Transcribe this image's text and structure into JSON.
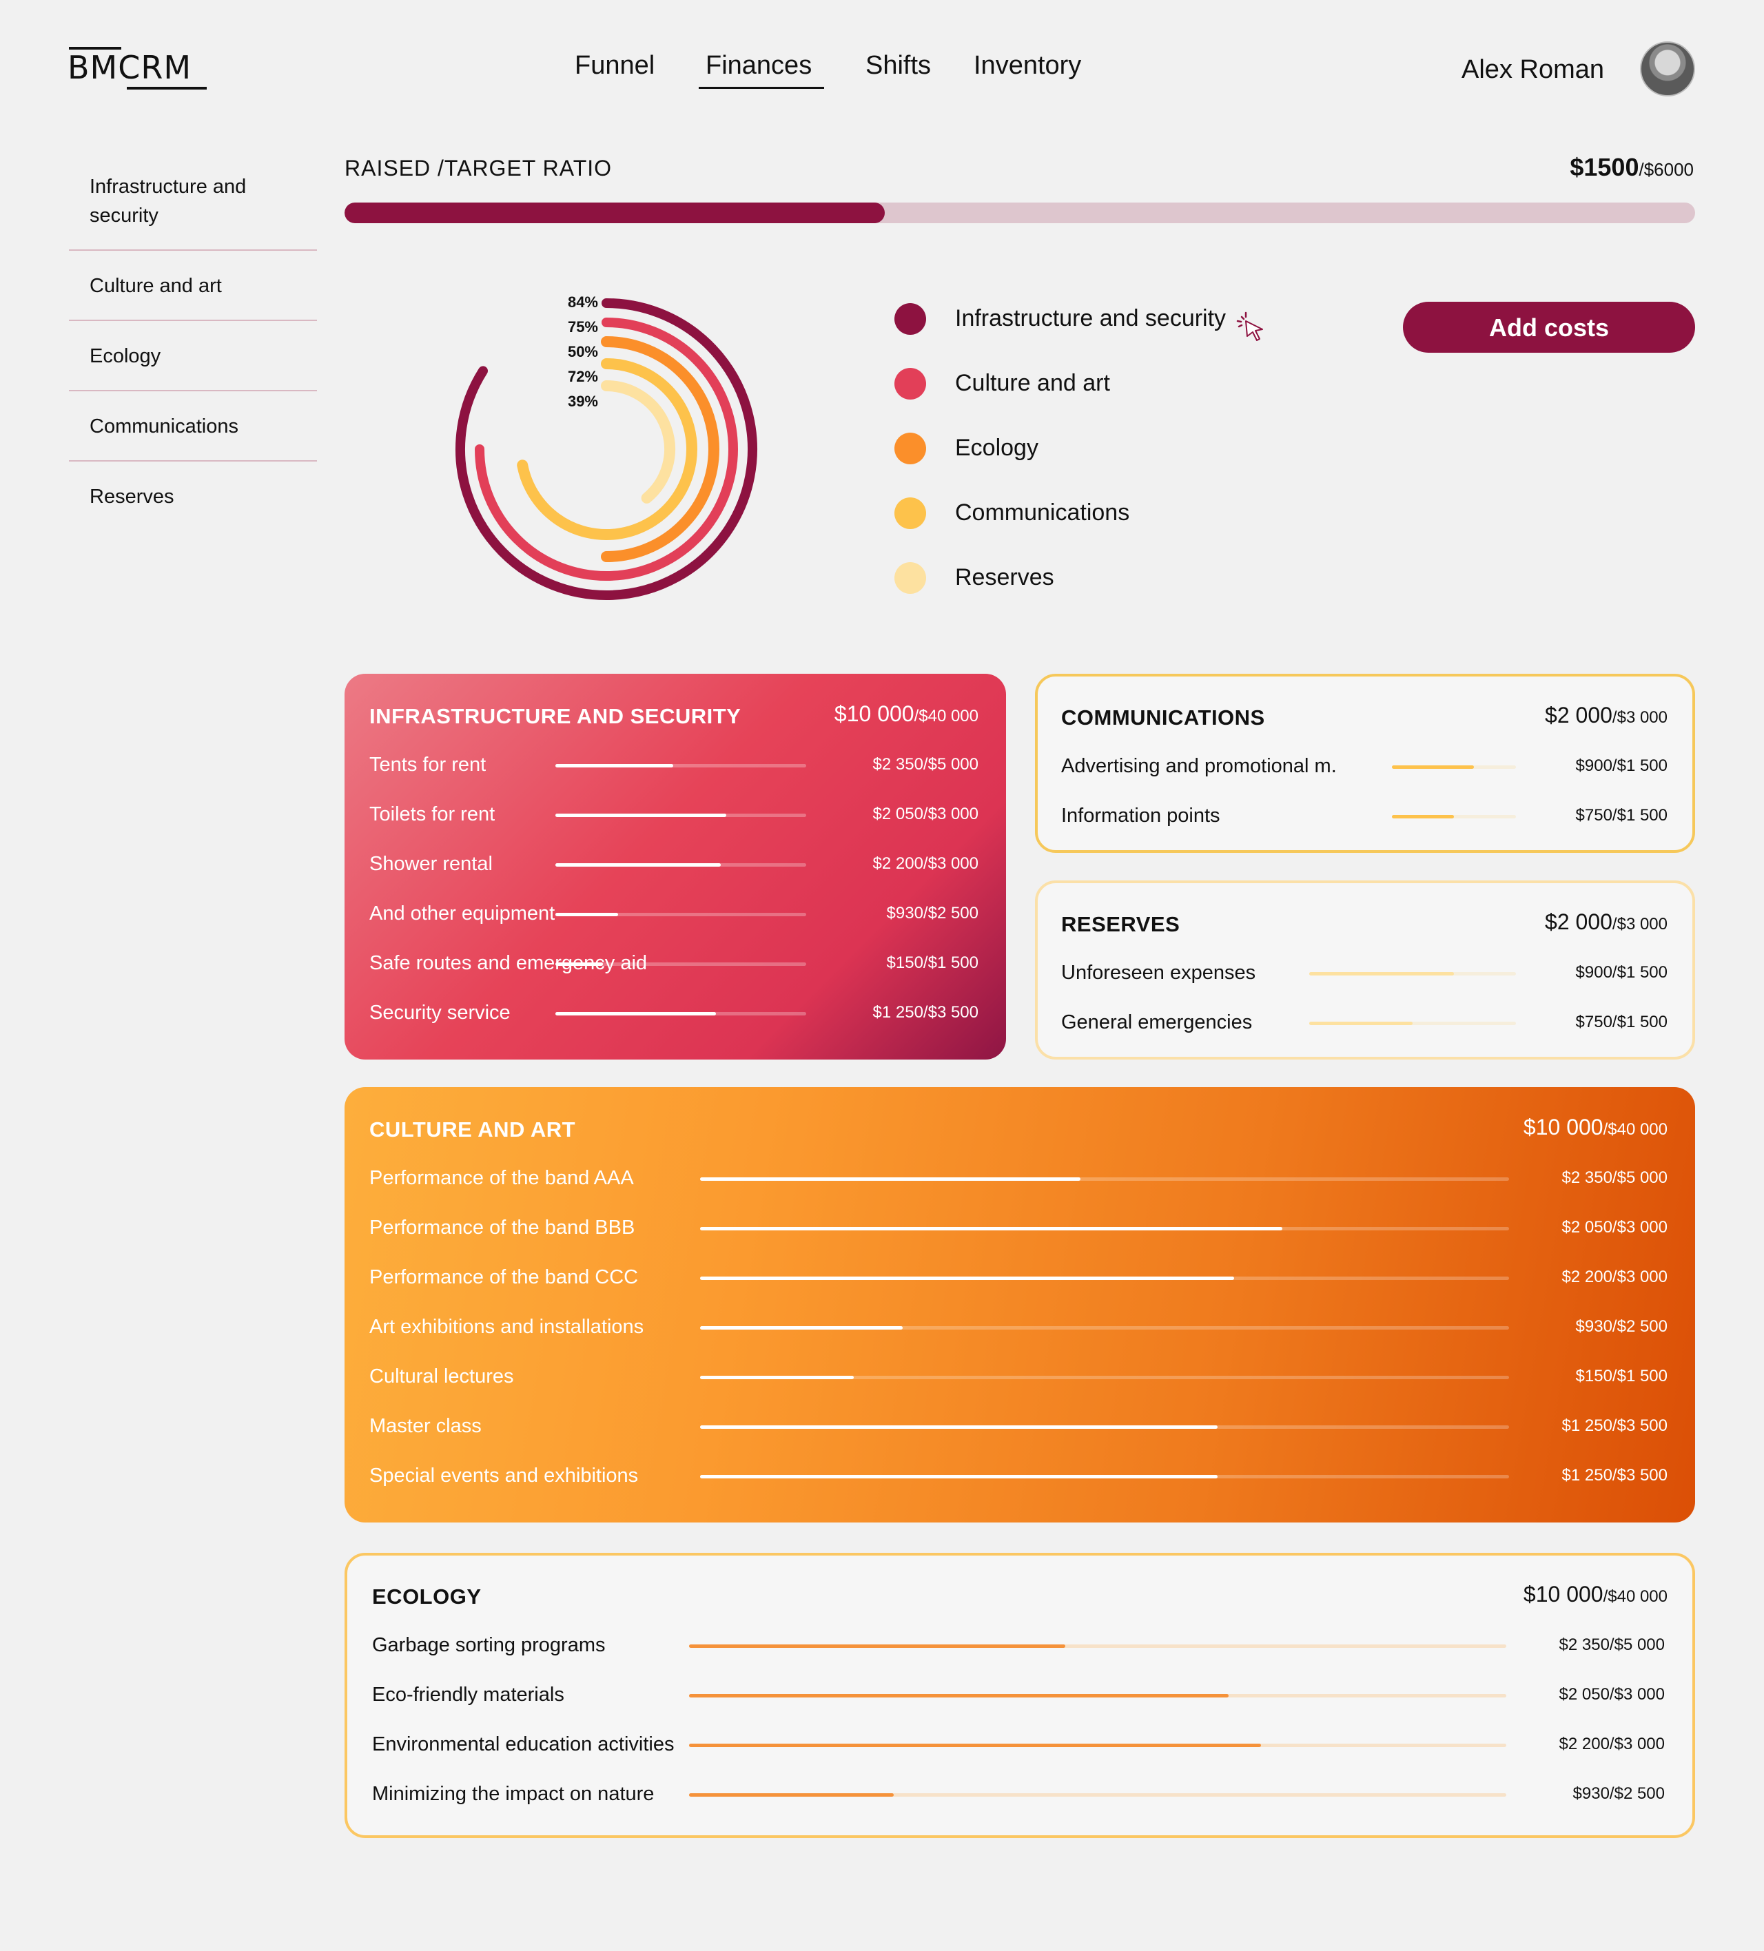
{
  "brand": {
    "logo": "BMCRM"
  },
  "nav": {
    "items": [
      {
        "label": "Funnel",
        "active": false
      },
      {
        "label": "Finances",
        "active": true
      },
      {
        "label": "Shifts",
        "active": false
      },
      {
        "label": "Inventory",
        "active": false
      }
    ]
  },
  "user": {
    "name": "Alex Roman",
    "avatar": "avatar-photo"
  },
  "sidebar": {
    "items": [
      {
        "label": "Infrastructure and security"
      },
      {
        "label": "Culture and art"
      },
      {
        "label": "Ecology"
      },
      {
        "label": "Communications"
      },
      {
        "label": "Reserves"
      }
    ]
  },
  "ratio": {
    "label": "RAISED /TARGET RATIO",
    "raised": "$1500",
    "target": "/$6000",
    "fraction": 0.4
  },
  "donut": {
    "rings": [
      {
        "label": "84%",
        "value": 0.84,
        "color": "#8d1240"
      },
      {
        "label": "75%",
        "value": 0.75,
        "color": "#e23f58"
      },
      {
        "label": "50%",
        "value": 0.5,
        "color": "#fb8f2a"
      },
      {
        "label": "72%",
        "value": 0.72,
        "color": "#fdc24b"
      },
      {
        "label": "39%",
        "value": 0.39,
        "color": "#fde1a0"
      }
    ]
  },
  "legend": {
    "items": [
      {
        "label": "Infrastructure and security",
        "color": "#8d1240"
      },
      {
        "label": "Culture and art",
        "color": "#e23f58"
      },
      {
        "label": "Ecology",
        "color": "#fb8f2a"
      },
      {
        "label": "Communications",
        "color": "#fdc24b"
      },
      {
        "label": "Reserves",
        "color": "#fde1a0"
      }
    ]
  },
  "actions": {
    "add_costs": "Add costs"
  },
  "cards": {
    "infra": {
      "title": "INFRASTRUCTURE AND SECURITY",
      "total": "$10 000",
      "target": "/$40 000",
      "rows": [
        {
          "label": "Tents for rent",
          "amount": "$2 350/$5 000",
          "progress": 0.47
        },
        {
          "label": "Toilets for rent",
          "amount": "$2 050/$3 000",
          "progress": 0.68
        },
        {
          "label": "Shower rental",
          "amount": "$2 200/$3 000",
          "progress": 0.66
        },
        {
          "label": "And other equipment",
          "amount": "$930/$2 500",
          "progress": 0.25
        },
        {
          "label": "Safe routes and emergency aid",
          "amount": "$150/$1 500",
          "progress": 0.19
        },
        {
          "label": "Security service",
          "amount": "$1 250/$3 500",
          "progress": 0.64
        }
      ]
    },
    "comm": {
      "title": "COMMUNICATIONS",
      "total": "$2 000",
      "target": "/$3 000",
      "rows": [
        {
          "label": "Advertising and promotional m.",
          "amount": "$900/$1 500",
          "progress": 0.66
        },
        {
          "label": "Information points",
          "amount": "$750/$1 500",
          "progress": 0.5
        }
      ]
    },
    "res": {
      "title": "RESERVES",
      "total": "$2 000",
      "target": "/$3 000",
      "rows": [
        {
          "label": "Unforeseen expenses",
          "amount": "$900/$1 500",
          "progress": 0.7
        },
        {
          "label": "General emergencies",
          "amount": "$750/$1 500",
          "progress": 0.5
        }
      ]
    },
    "cult": {
      "title": "CULTURE AND ART",
      "total": "$10 000",
      "target": "/$40 000",
      "rows": [
        {
          "label": "Performance of the band AAA",
          "amount": "$2 350/$5 000",
          "progress": 0.47
        },
        {
          "label": "Performance of the band BBB",
          "amount": "$2 050/$3 000",
          "progress": 0.72
        },
        {
          "label": "Performance of the band CCC",
          "amount": "$2 200/$3 000",
          "progress": 0.66
        },
        {
          "label": "Art exhibitions and installations",
          "amount": "$930/$2 500",
          "progress": 0.25
        },
        {
          "label": "Cultural lectures",
          "amount": "$150/$1 500",
          "progress": 0.19
        },
        {
          "label": "Master class",
          "amount": "$1 250/$3 500",
          "progress": 0.64
        },
        {
          "label": "Special events and exhibitions",
          "amount": "$1 250/$3 500",
          "progress": 0.64
        }
      ]
    },
    "eco": {
      "title": "ECOLOGY",
      "total": "$10 000",
      "target": "/$40 000",
      "rows": [
        {
          "label": "Garbage sorting programs",
          "amount": "$2 350/$5 000",
          "progress": 0.46
        },
        {
          "label": "Eco-friendly materials",
          "amount": "$2 050/$3 000",
          "progress": 0.66
        },
        {
          "label": "Environmental education activities",
          "amount": "$2 200/$3 000",
          "progress": 0.7
        },
        {
          "label": "Minimizing the impact on nature",
          "amount": "$930/$2 500",
          "progress": 0.25
        }
      ]
    }
  }
}
